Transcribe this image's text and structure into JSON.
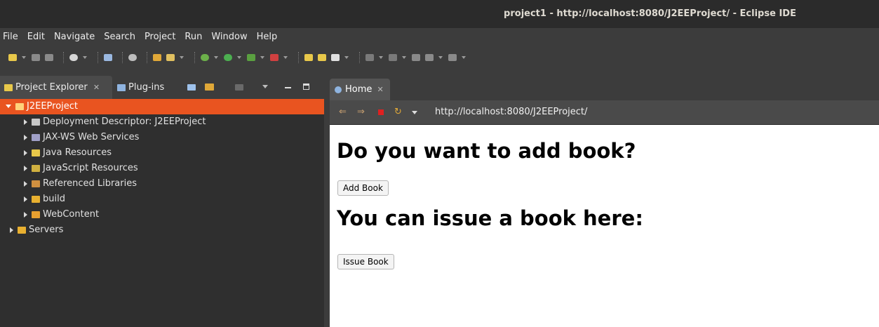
{
  "window": {
    "title": "project1 - http://localhost:8080/J2EEProject/ - Eclipse IDE"
  },
  "menu": [
    "File",
    "Edit",
    "Navigate",
    "Search",
    "Project",
    "Run",
    "Window",
    "Help"
  ],
  "left_tabs": {
    "project_explorer": "Project Explorer",
    "plugins": "Plug-ins"
  },
  "tree": {
    "root": "J2EEProject",
    "children": [
      "Deployment Descriptor: J2EEProject",
      "JAX-WS Web Services",
      "Java Resources",
      "JavaScript Resources",
      "Referenced Libraries",
      "build",
      "WebContent"
    ],
    "servers": "Servers"
  },
  "editor": {
    "tab_label": "Home",
    "url": "http://localhost:8080/J2EEProject/"
  },
  "page": {
    "heading1": "Do you want to add book?",
    "button1": "Add Book",
    "heading2": "You can issue a book here:",
    "button2": "Issue Book"
  },
  "colors": {
    "selection": "#e95420",
    "background": "#3c3c3c"
  }
}
